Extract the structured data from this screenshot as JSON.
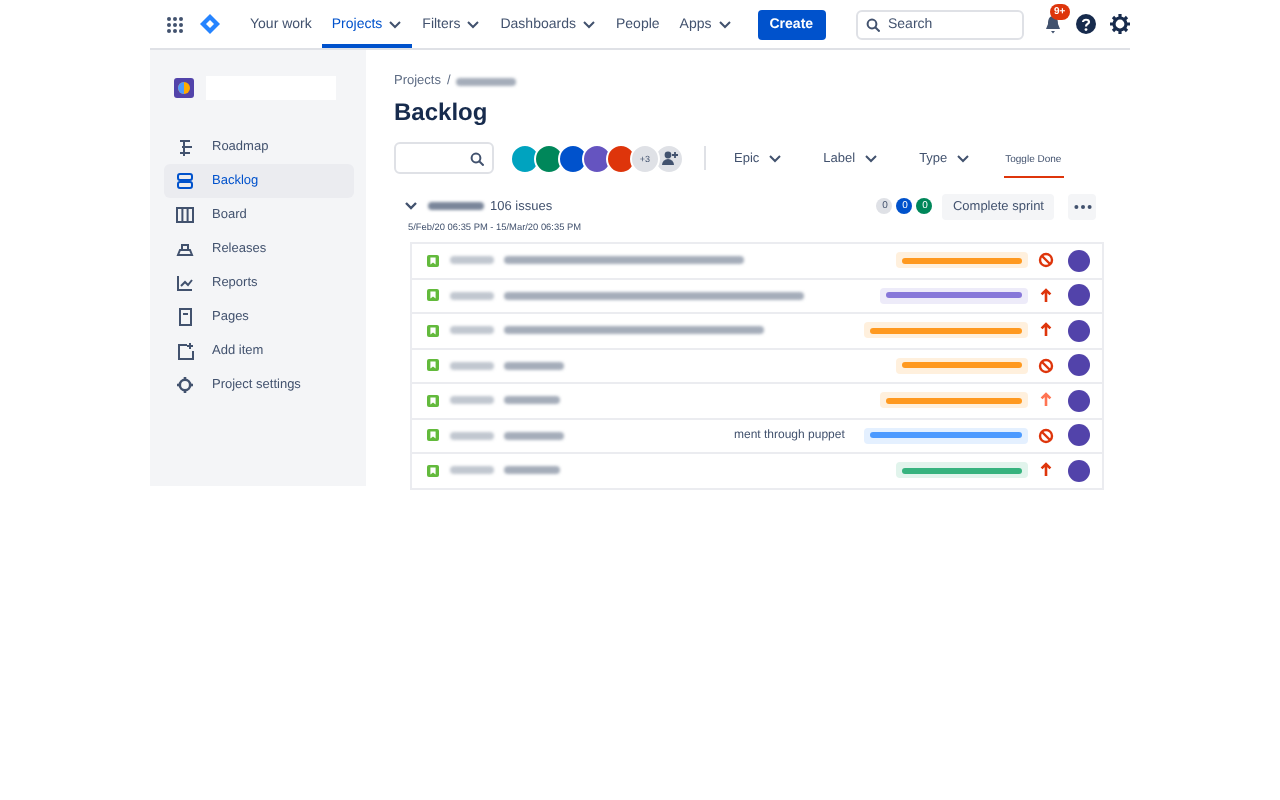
{
  "topbar": {
    "nav": [
      {
        "label": "Your work",
        "dropdown": false,
        "selected": false
      },
      {
        "label": "Projects",
        "dropdown": true,
        "selected": true
      },
      {
        "label": "Filters",
        "dropdown": true,
        "selected": false
      },
      {
        "label": "Dashboards",
        "dropdown": true,
        "selected": false
      },
      {
        "label": "People",
        "dropdown": false,
        "selected": false
      },
      {
        "label": "Apps",
        "dropdown": true,
        "selected": false
      }
    ],
    "create": "Create",
    "search": {
      "placeholder": "Search"
    },
    "notifications": "9+"
  },
  "sidebar": {
    "items": [
      {
        "label": "Roadmap",
        "kind": "roadmap",
        "selected": false
      },
      {
        "label": "Backlog",
        "kind": "backlog",
        "selected": true
      },
      {
        "label": "Board",
        "kind": "board",
        "selected": false
      },
      {
        "label": "Releases",
        "kind": "releases",
        "selected": false
      },
      {
        "label": "Reports",
        "kind": "reports",
        "selected": false
      },
      {
        "label": "Pages",
        "kind": "pages",
        "selected": false
      },
      {
        "label": "Add item",
        "kind": "add",
        "selected": false
      },
      {
        "label": "Project settings",
        "kind": "settings",
        "selected": false
      }
    ]
  },
  "breadcrumb": {
    "root": "Projects",
    "separator": "/"
  },
  "title": "Backlog",
  "toolbar": {
    "members": [
      {
        "color": "#00a3bf"
      },
      {
        "color": "#00875a"
      },
      {
        "color": "#0052cc"
      },
      {
        "color": "#6554c0"
      },
      {
        "color": "#de350b"
      }
    ],
    "more_members": "+3",
    "filters": [
      {
        "label": "Epic"
      },
      {
        "label": "Label"
      },
      {
        "label": "Type"
      }
    ],
    "toggle": {
      "label": "Toggle Done",
      "selected": true
    }
  },
  "sprint": {
    "expanded": true,
    "issue_count": "106 issues",
    "dates": "5/Feb/20 06:35 PM - 15/Mar/20 06:35 PM",
    "counts": [
      {
        "value": "0",
        "color": "#dfe1e6"
      },
      {
        "value": "0",
        "color": "#0052cc"
      },
      {
        "value": "0",
        "color": "#00875a"
      }
    ],
    "complete_button": "Complete sprint"
  },
  "issues": [
    {
      "color": "#ff991f",
      "kind": "blocker"
    },
    {
      "color": "#8777d9",
      "kind": "highest"
    },
    {
      "color": "#ff991f",
      "kind": "highest"
    },
    {
      "color": "#ff991f",
      "kind": "blocker"
    },
    {
      "color": "#ff991f",
      "kind": "high"
    },
    {
      "color": "#4c9aff",
      "kind": "blocker",
      "summary_visible": "ment through puppet"
    },
    {
      "color": "#36b37e",
      "kind": "highest"
    }
  ]
}
